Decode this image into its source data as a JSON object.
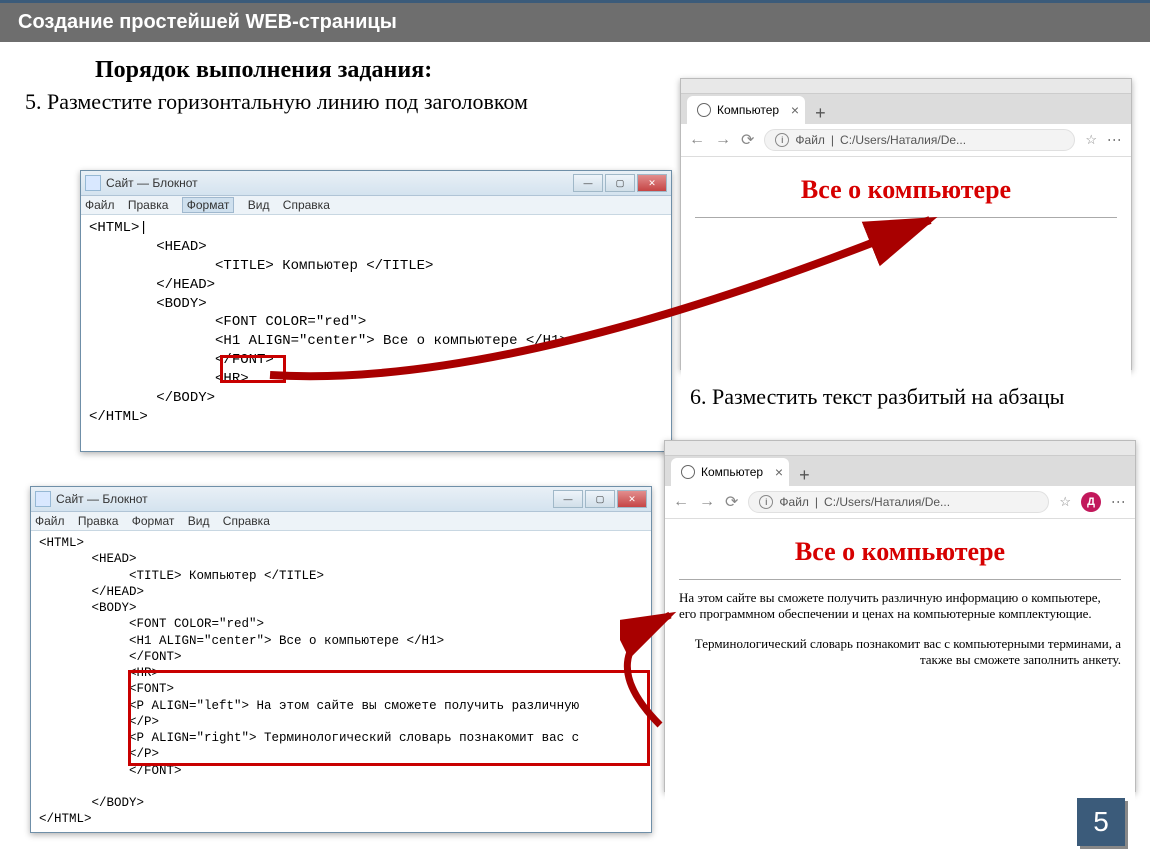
{
  "header": "Создание простейшей WEB-страницы",
  "subheader": "Порядок выполнения задания:",
  "step5": "5. Разместите горизонтальную линию под заголовком",
  "step6": "6. Разместить текст разбитый на абзацы",
  "page_number": "5",
  "notepad1": {
    "title": "Сайт — Блокнот",
    "menu": {
      "file": "Файл",
      "edit": "Правка",
      "format": "Формат",
      "view": "Вид",
      "help": "Справка"
    },
    "code": "<HTML>|\n        <HEAD>\n               <TITLE> Компьютер </TITLE>\n        </HEAD>\n        <BODY>\n               <FONT COLOR=\"red\">\n               <H1 ALIGN=\"center\"> Все о компьютере </H1>\n               </FONT>\n               <HR>\n        </BODY>\n</HTML>"
  },
  "notepad2": {
    "title": "Сайт — Блокнот",
    "menu": {
      "file": "Файл",
      "edit": "Правка",
      "format": "Формат",
      "view": "Вид",
      "help": "Справка"
    },
    "code": "<HTML>\n       <HEAD>\n            <TITLE> Компьютер </TITLE>\n       </HEAD>\n       <BODY>\n            <FONT COLOR=\"red\">\n            <H1 ALIGN=\"center\"> Все о компьютере </H1>\n            </FONT>\n            <HR>\n            <FONT>\n            <P ALIGN=\"left\"> На этом сайте вы сможете получить различную\n            </P>\n            <P ALIGN=\"right\"> Терминологический словарь познакомит вас с\n            </P>\n            </FONT>\n\n       </BODY>\n</HTML>"
  },
  "browser1": {
    "tab": "Компьютер",
    "url_prefix": "Файл",
    "url_path": "C:/Users/Наталия/De...",
    "heading": "Все о компьютере"
  },
  "browser2": {
    "tab": "Компьютер",
    "url_prefix": "Файл",
    "url_path": "C:/Users/Наталия/De...",
    "avatar": "Д",
    "heading": "Все о компьютере",
    "para1": "На этом сайте вы сможете получить различную информацию о компьютере, его программном обеспечении и ценах на компьютерные комплектующие.",
    "para2": "Терминологический словарь познакомит вас с компьютерными терминами, а также вы сможете заполнить анкету."
  }
}
